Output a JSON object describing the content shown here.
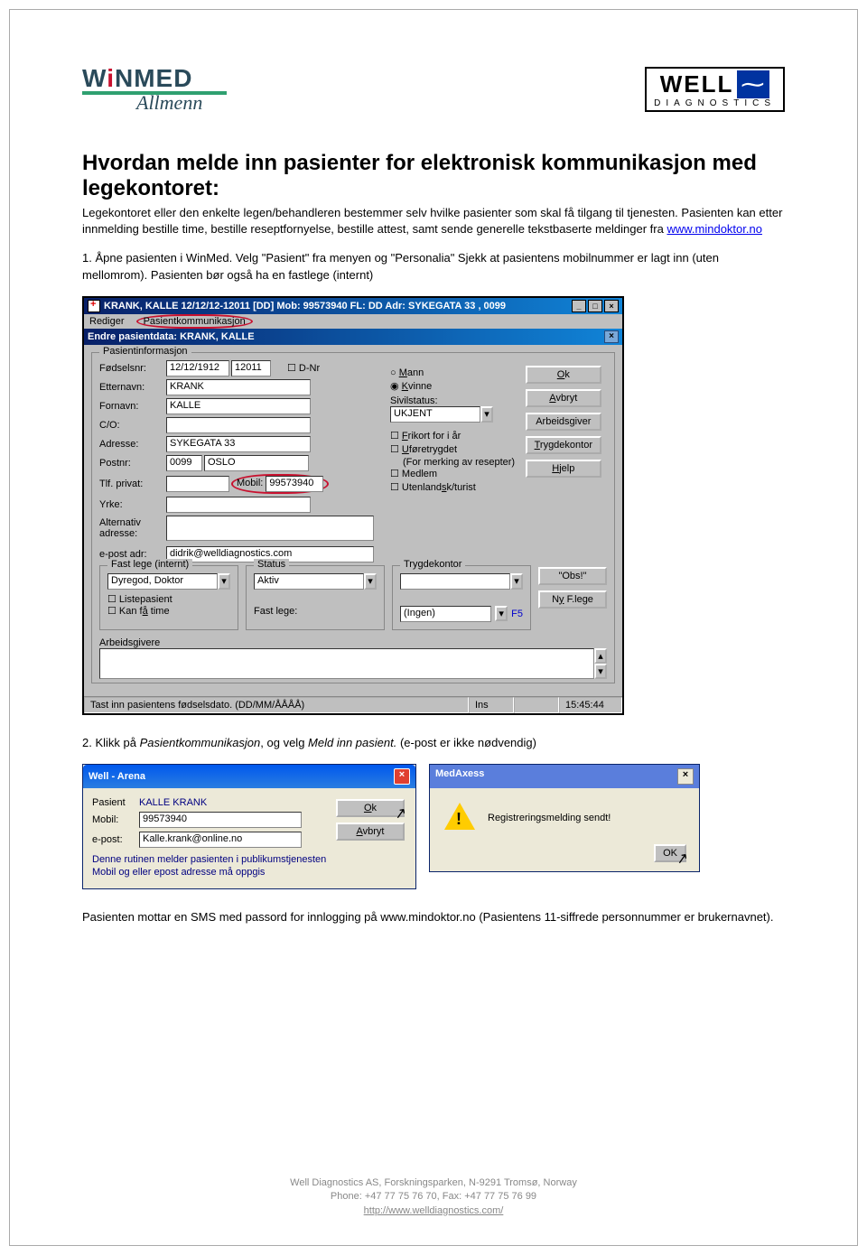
{
  "logos": {
    "winmed_brand": "WINMED",
    "winmed_sub": "Allmenn",
    "well_main": "WELL",
    "well_sub": "DIAGNOSTICS"
  },
  "title": "Hvordan melde inn pasienter for elektronisk kommunikasjon med legekontoret:",
  "intro_1": "Legekontoret eller den enkelte legen/behandleren bestemmer selv hvilke pasienter som skal få tilgang til tjenesten. Pasienten kan etter innmelding bestille time, bestille reseptfornyelse, bestille attest, samt sende generelle tekstbaserte meldinger fra ",
  "intro_link": "www.mindoktor.no",
  "step1": "1. Åpne pasienten i WinMed. Velg \"Pasient\" fra menyen og \"Personalia\" Sjekk at pasientens mobilnummer er lagt inn (uten mellomrom). Pasienten bør også ha en fastlege (internt)",
  "step2_a": "2. Klikk på ",
  "step2_b": "Pasientkommunikasjon",
  "step2_c": ", og velg ",
  "step2_d": "Meld inn pasient.",
  "step2_e": " (e-post er ikke nødvendig)",
  "final": "Pasienten mottar en SMS med passord for innlogging på www.mindoktor.no (Pasientens 11-siffrede personnummer er brukernavnet).",
  "sc1": {
    "title": "KRANK, KALLE 12/12/12-12011 [DD] Mob: 99573940 FL: DD Adr: SYKEGATA 33 , 0099",
    "menu_rediger": "Rediger",
    "menu_pk": "Pasientkommunikasjon",
    "sub_title": "Endre pasientdata: KRANK, KALLE",
    "legend_pinfo": "Pasientinformasjon",
    "lbl_fodselsnr": "Fødselsnr:",
    "val_fodsel_d": "12/12/1912",
    "val_fodsel_n": "12011",
    "lbl_dnr": "D-Nr",
    "lbl_etternavn": "Etternavn:",
    "val_etternavn": "KRANK",
    "lbl_fornavn": "Fornavn:",
    "val_fornavn": "KALLE",
    "lbl_co": "C/O:",
    "lbl_adresse": "Adresse:",
    "val_adresse": "SYKEGATA 33",
    "lbl_postnr": "Postnr:",
    "val_postnr": "0099",
    "val_poststed": "OSLO",
    "lbl_tlfpriv": "Tlf. privat:",
    "lbl_mobil": "Mobil:",
    "val_mobil": "99573940",
    "lbl_yrke": "Yrke:",
    "lbl_altadr": "Alternativ adresse:",
    "lbl_epost": "e-post adr:",
    "val_epost": "didrik@welldiagnostics.com",
    "radio_mann": "Mann",
    "radio_kvinne": "Kvinne",
    "lbl_sivil": "Sivilstatus:",
    "val_sivil": "UKJENT",
    "chk_frikort": "Frikort for i år",
    "chk_ufor": "Uføretrygdet",
    "chk_ufor_sub": "(For merking av resepter)",
    "chk_medlem": "Medlem",
    "chk_utenl": "Utenlandsk/turist",
    "btn_ok": "Ok",
    "btn_avbryt": "Avbryt",
    "btn_arb": "Arbeidsgiver",
    "btn_trygd": "Trygdekontor",
    "btn_hjelp": "Hjelp",
    "btn_obs": "\"Obs!\"",
    "btn_nyf": "Ny F.lege",
    "legend_fastlege": "Fast lege (internt)",
    "val_fastlege": "Dyregod, Doktor",
    "chk_liste": "Listepasient",
    "chk_kanfa": "Kan få time",
    "legend_status": "Status",
    "val_status": "Aktiv",
    "lbl_fastlege2": "Fast lege:",
    "val_fastlege2": "(Ingen)",
    "f5": "F5",
    "legend_trygde": "Trygdekontor",
    "legend_arb": "Arbeidsgivere",
    "status_hint": "Tast inn pasientens fødselsdato. (DD/MM/ÅÅÅÅ)",
    "status_ins": "Ins",
    "status_time": "15:45:44"
  },
  "sc2": {
    "title": "Well - Arena",
    "lbl_pasient": "Pasient",
    "val_pasient": "KALLE KRANK",
    "lbl_mobil": "Mobil:",
    "val_mobil": "99573940",
    "lbl_epost": "e-post:",
    "val_epost": "Kalle.krank@online.no",
    "note1": "Denne rutinen melder pasienten i publikumstjenesten",
    "note2": "Mobil og eller epost adresse må oppgis",
    "btn_ok": "Ok",
    "btn_avbryt": "Avbryt"
  },
  "sc3": {
    "title": "MedAxess",
    "msg": "Registreringsmelding sendt!",
    "btn_ok": "OK"
  },
  "footer": {
    "l1": "Well Diagnostics AS, Forskningsparken, N-9291 Tromsø, Norway",
    "l2": "Phone: +47 77 75 76 70, Fax: +47 77 75 76 99",
    "l3": "http://www.welldiagnostics.com/"
  }
}
